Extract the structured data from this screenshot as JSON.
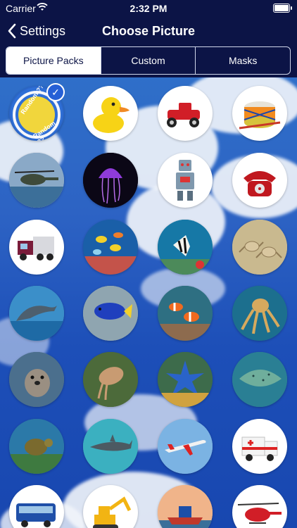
{
  "status": {
    "carrier": "Carrier",
    "time": "2:32 PM"
  },
  "nav": {
    "back_label": "Settings",
    "title": "Choose Picture"
  },
  "tabs": [
    {
      "label": "Picture Packs",
      "active": true
    },
    {
      "label": "Custom",
      "active": false
    },
    {
      "label": "Masks",
      "active": false
    }
  ],
  "random_pack": {
    "top_text": "Random ??",
    "bottom_text": "Random ??"
  },
  "pictures": [
    "random",
    "rubber-duck",
    "toy-car",
    "toy-drum",
    "helicopter",
    "jellyfish",
    "toy-robot",
    "red-telephone",
    "truck",
    "tropical-fish",
    "angelfish",
    "crabs",
    "dolphin",
    "blue-tang-fish",
    "clownfish",
    "octopus",
    "seal",
    "cuttlefish",
    "starfish",
    "stingray",
    "sea-turtle",
    "shark",
    "airplane",
    "ambulance",
    "bus",
    "excavator",
    "boat",
    "rescue-helicopter"
  ],
  "colors": {
    "nav_background": "#0c1446",
    "accent": "#2660d6"
  }
}
